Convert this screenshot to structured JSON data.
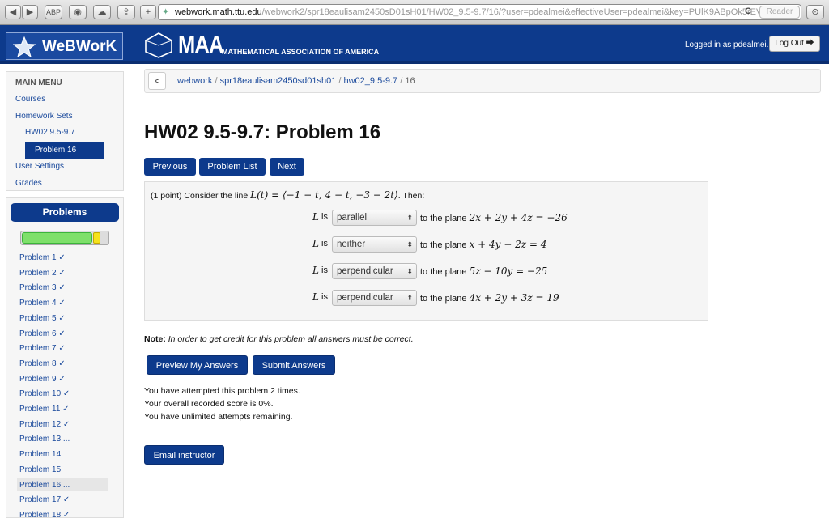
{
  "browser": {
    "url_host": "webwork.math.ttu.edu",
    "url_rest": "/webwork2/spr18eaulisam2450sD01sH01/HW02_9.5-9.7/16/?user=pdealmei&effectiveUser=pdealmei&key=PUlK9ABpOk5rEVr",
    "reader_label": "Reader",
    "back_glyph": "◀",
    "forward_glyph": "▶",
    "plus_glyph": "+",
    "reload_glyph": "C",
    "download_glyph": "⊙"
  },
  "header": {
    "logo_text": "WeBWorK",
    "maa_big": "MAA",
    "maa_small": "MATHEMATICAL ASSOCIATION OF AMERICA",
    "login_text": "Logged in as pdealmei.",
    "logout_label": "Log Out ⮕"
  },
  "sidebar": {
    "menu_title": "MAIN MENU",
    "courses": "Courses",
    "homework_sets": "Homework Sets",
    "hw_set": "HW02 9.5-9.7",
    "current_problem": "Problem 16",
    "user_settings": "User Settings",
    "grades": "Grades",
    "problems_title": "Problems",
    "progress": {
      "completed_fraction": 0.82,
      "current_fraction": 0.07
    },
    "problems": [
      "Problem 1 ✓",
      "Problem 2 ✓",
      "Problem 3 ✓",
      "Problem 4 ✓",
      "Problem 5 ✓",
      "Problem 6 ✓",
      "Problem 7 ✓",
      "Problem 8 ✓",
      "Problem 9 ✓",
      "Problem 10 ✓",
      "Problem 11 ✓",
      "Problem 12 ✓",
      "Problem 13 ...",
      "Problem 14",
      "Problem 15",
      "Problem 16 ...",
      "Problem 17 ✓",
      "Problem 18 ✓"
    ]
  },
  "breadcrumb": {
    "back": "<",
    "part1": "webwork",
    "sep": "/",
    "part2": "spr18eaulisam2450sd01sh01",
    "part3": "hw02_9.5-9.7",
    "part4": "16"
  },
  "main": {
    "title": "HW02 9.5-9.7: Problem 16",
    "nav": {
      "previous": "Previous",
      "problem_list": "Problem List",
      "next": "Next"
    },
    "intro_prefix": "(1 point) Consider the line ",
    "intro_math": "L(t) = ⟨−1 − t, 4 − t, −3 − 2t⟩",
    "intro_suffix": ". Then:",
    "rows": [
      {
        "L": "L",
        "is": "is",
        "selected": "parallel",
        "to_plane": "to the plane ",
        "equation": "2x + 2y + 4z = −26"
      },
      {
        "L": "L",
        "is": "is",
        "selected": "neither",
        "to_plane": "to the plane ",
        "equation": "x + 4y − 2z = 4"
      },
      {
        "L": "L",
        "is": "is",
        "selected": "perpendicular",
        "to_plane": "to the plane ",
        "equation": "5z − 10y = −25"
      },
      {
        "L": "L",
        "is": "is",
        "selected": "perpendicular",
        "to_plane": "to the plane ",
        "equation": "4x + 2y + 3z = 19"
      }
    ],
    "select_arrow": "⬍",
    "note_bold": "Note:",
    "note_text": " In order to get credit for this problem all answers must be correct.",
    "preview_label": "Preview My Answers",
    "submit_label": "Submit Answers",
    "status1": "You have attempted this problem 2 times.",
    "status2": "Your overall recorded score is 0%.",
    "status3": "You have unlimited attempts remaining.",
    "email_label": "Email instructor"
  }
}
